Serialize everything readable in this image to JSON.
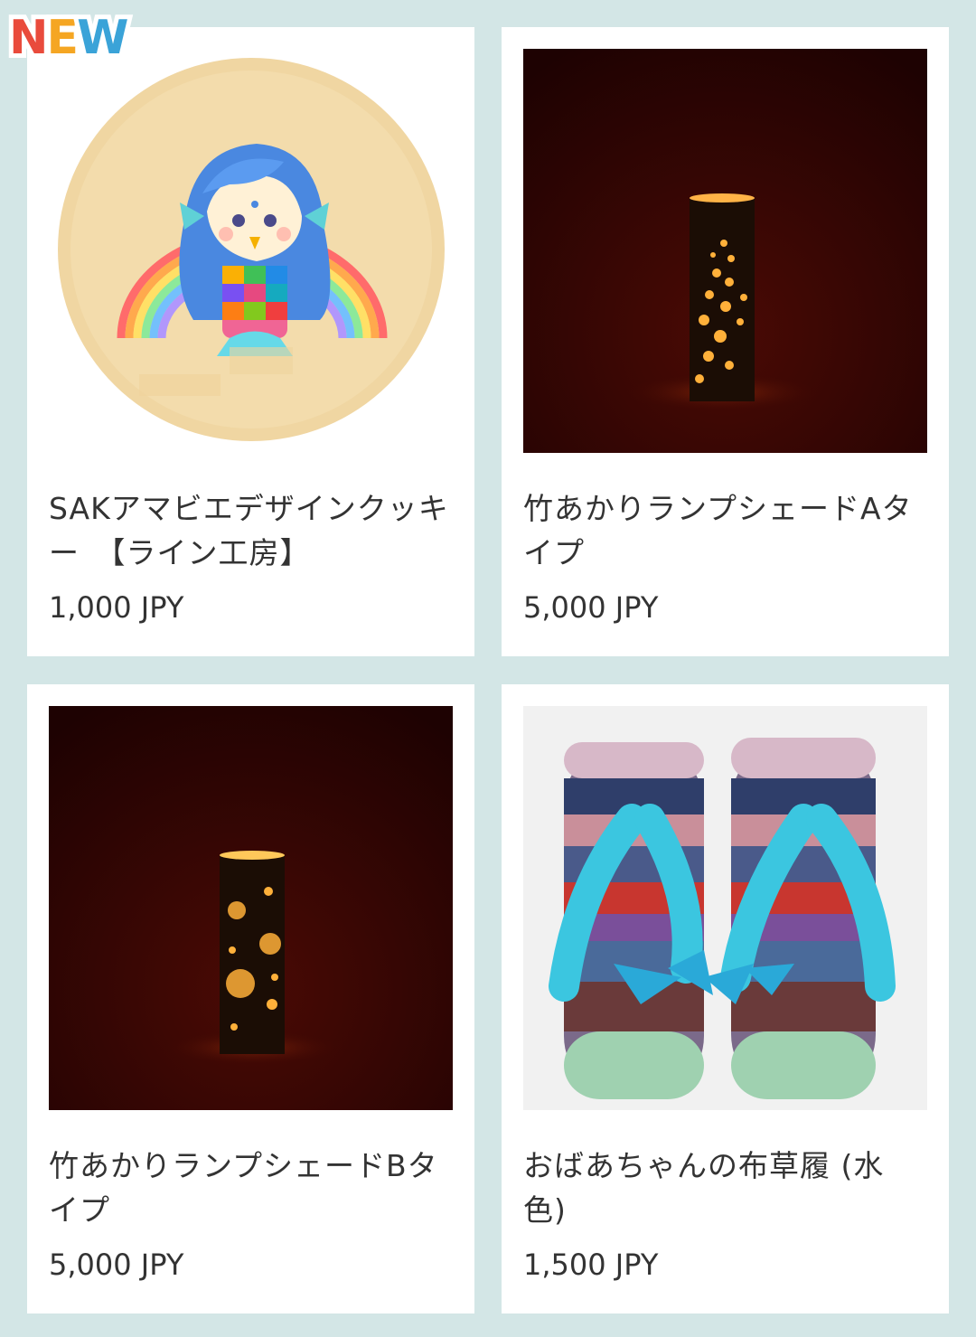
{
  "badge": {
    "label_chars": [
      "N",
      "E",
      "W"
    ],
    "colors": [
      "#e94b3c",
      "#f5a623",
      "#3aa3d8"
    ]
  },
  "products": [
    {
      "title": "SAKアマビエデザインクッキー　【ライン工房】",
      "price": "1,000 JPY",
      "image": "amabie-cookie"
    },
    {
      "title": "竹あかりランプシェードAタイプ",
      "price": "5,000 JPY",
      "image": "bamboo-lamp-a"
    },
    {
      "title": "竹あかりランプシェードBタイプ",
      "price": "5,000 JPY",
      "image": "bamboo-lamp-b"
    },
    {
      "title": "おばあちゃんの布草履 (水色)",
      "price": "1,500 JPY",
      "image": "cloth-sandals"
    }
  ]
}
